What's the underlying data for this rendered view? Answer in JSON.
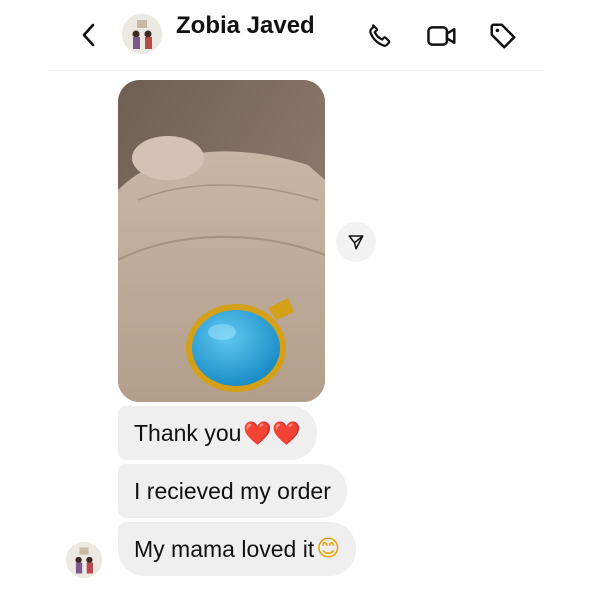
{
  "header": {
    "title": "Zobia Javed",
    "icons": [
      "chevron-left-icon",
      "phone-icon",
      "video-icon",
      "tag-icon"
    ]
  },
  "messages": [
    {
      "text": "Thank you",
      "emoji": "❤️❤️"
    },
    {
      "text": "I recieved my order",
      "emoji": ""
    },
    {
      "text": "My mama loved it",
      "emoji": "😊"
    }
  ],
  "colors": {
    "bubble": "#efefef",
    "heart": "#e0202a",
    "stone": "#1ea0d8",
    "gold": "#d4a017"
  }
}
